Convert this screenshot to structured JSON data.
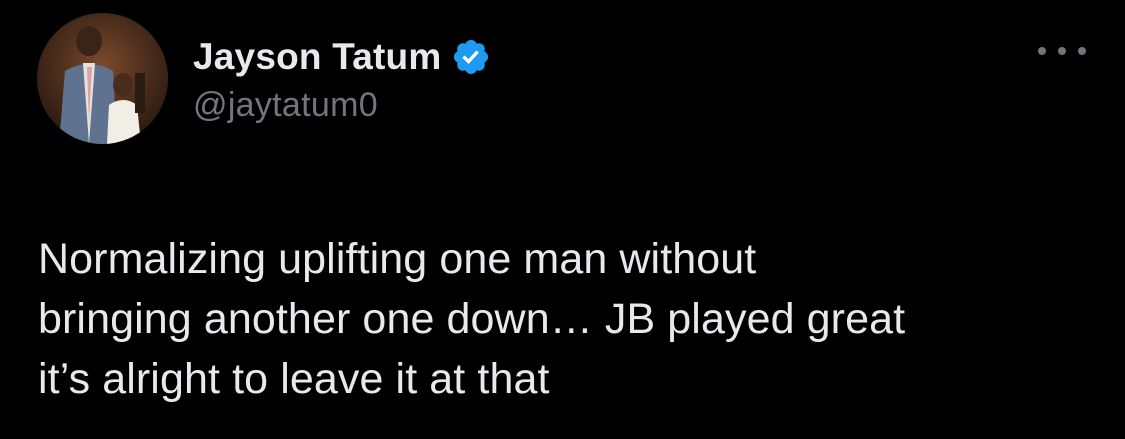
{
  "author": {
    "display_name": "Jayson Tatum",
    "handle": "@jaytatum0",
    "verified": true,
    "avatar_icon": "profile-photo"
  },
  "menu": {
    "icon": "more-horizontal-icon"
  },
  "tweet": {
    "lines": [
      "Normalizing uplifting one man without",
      "bringing another one down… JB played great",
      "it’s alright to leave it at that"
    ]
  },
  "colors": {
    "background": "#000000",
    "text_primary": "#e7e9ea",
    "text_secondary": "#71767b",
    "verified_blue": "#1d9bf0"
  }
}
